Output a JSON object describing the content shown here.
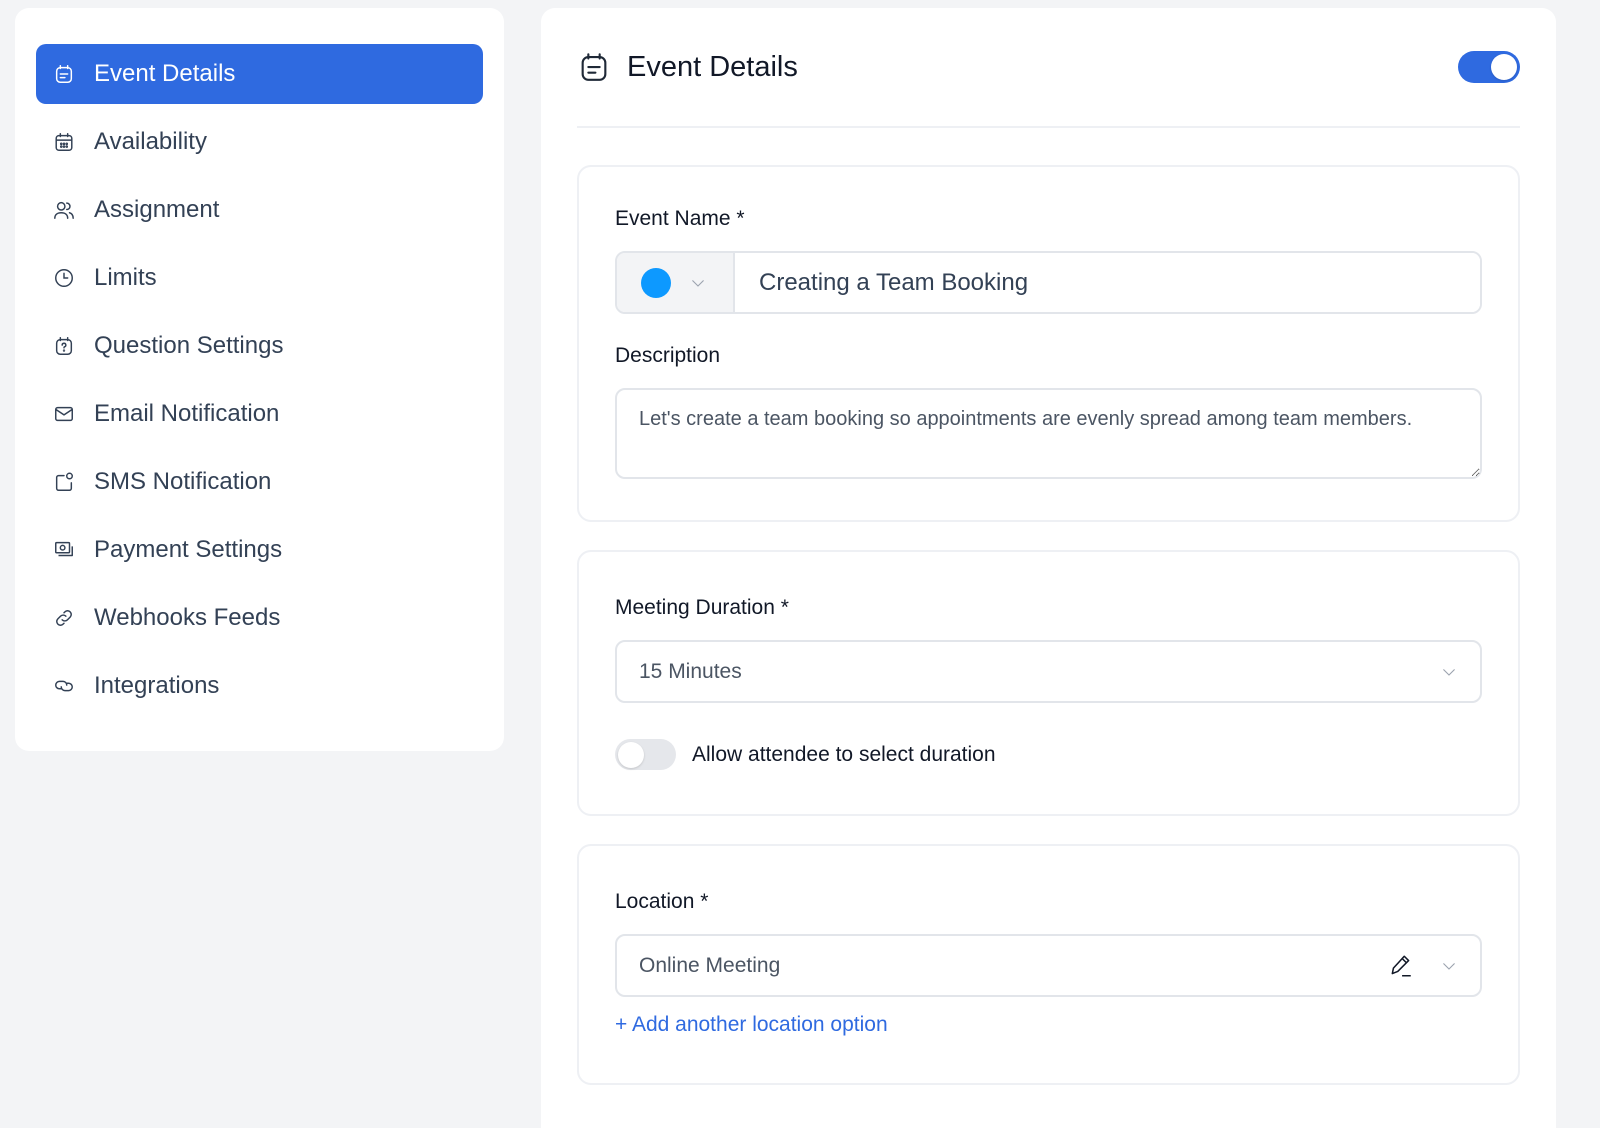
{
  "sidebar": {
    "items": [
      {
        "label": "Event Details",
        "icon": "calendar-note-icon",
        "active": true
      },
      {
        "label": "Availability",
        "icon": "calendar-icon",
        "active": false
      },
      {
        "label": "Assignment",
        "icon": "users-icon",
        "active": false
      },
      {
        "label": "Limits",
        "icon": "clock-icon",
        "active": false
      },
      {
        "label": "Question Settings",
        "icon": "calendar-question-icon",
        "active": false
      },
      {
        "label": "Email Notification",
        "icon": "envelope-icon",
        "active": false
      },
      {
        "label": "SMS Notification",
        "icon": "message-badge-icon",
        "active": false
      },
      {
        "label": "Payment Settings",
        "icon": "money-icon",
        "active": false
      },
      {
        "label": "Webhooks Feeds",
        "icon": "link-icon",
        "active": false
      },
      {
        "label": "Integrations",
        "icon": "integration-icon",
        "active": false
      }
    ]
  },
  "header": {
    "title": "Event Details",
    "icon": "calendar-note-icon",
    "enabled": true
  },
  "event_card": {
    "name_label": "Event Name *",
    "color": "#0d99ff",
    "name_value": "Creating a Team Booking",
    "description_label": "Description",
    "description_value": "Let's create a team booking so appointments are evenly spread among team members."
  },
  "duration_card": {
    "label": "Meeting Duration *",
    "selected": "15 Minutes",
    "allow_select_label": "Allow attendee to select duration",
    "allow_select_enabled": false
  },
  "location_card": {
    "label": "Location *",
    "selected": "Online Meeting",
    "add_link": "+ Add another location option"
  },
  "colors": {
    "accent": "#2f6ae0",
    "event_color": "#0d99ff"
  }
}
